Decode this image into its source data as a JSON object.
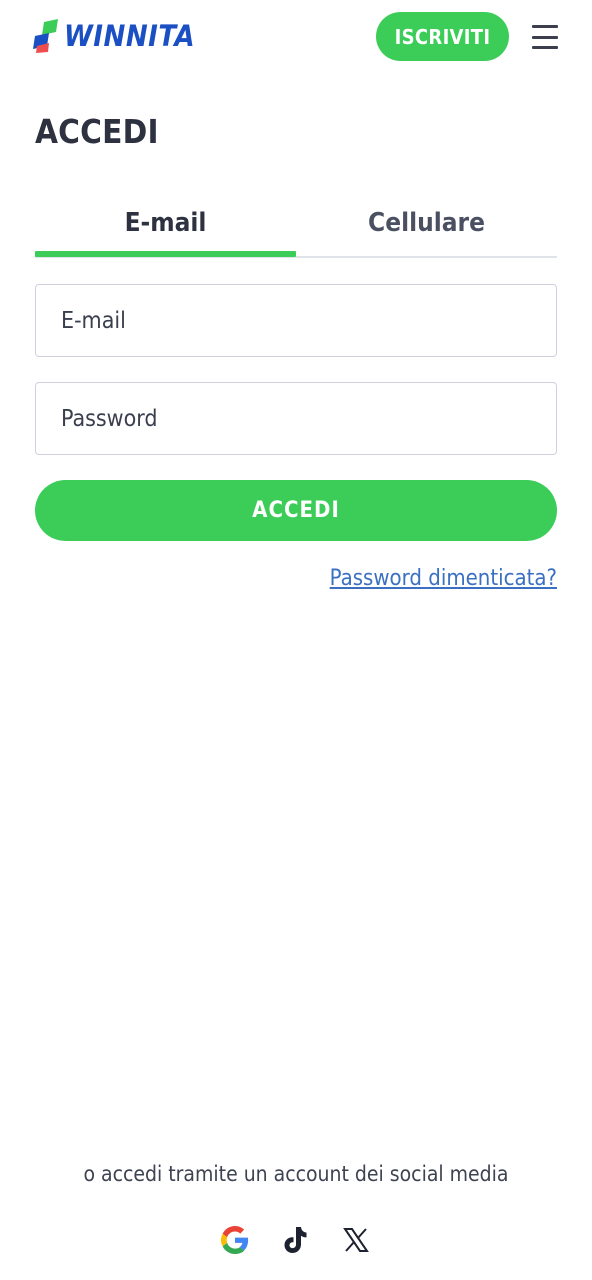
{
  "header": {
    "brand": "WINNITA",
    "signup_label": "ISCRIVITI",
    "menu_icon": "hamburger-menu-icon"
  },
  "page": {
    "title": "ACCEDI"
  },
  "tabs": [
    {
      "label": "E-mail",
      "active": true
    },
    {
      "label": "Cellulare",
      "active": false
    }
  ],
  "form": {
    "email_placeholder": "E-mail",
    "email_value": "",
    "password_placeholder": "Password",
    "password_value": "",
    "submit_label": "ACCEDI",
    "forgot_label": "Password dimenticata?"
  },
  "social": {
    "prompt": "o accedi tramite un account dei social media",
    "providers": [
      {
        "name": "Google",
        "icon": "google-icon"
      },
      {
        "name": "TikTok",
        "icon": "tiktok-icon"
      },
      {
        "name": "X",
        "icon": "x-icon"
      }
    ]
  },
  "colors": {
    "accent_green": "#3ccd58",
    "brand_blue": "#1b4fc4",
    "brand_red": "#f04e4e",
    "link_blue": "#3a6fc2",
    "text_dark": "#2d3140"
  }
}
